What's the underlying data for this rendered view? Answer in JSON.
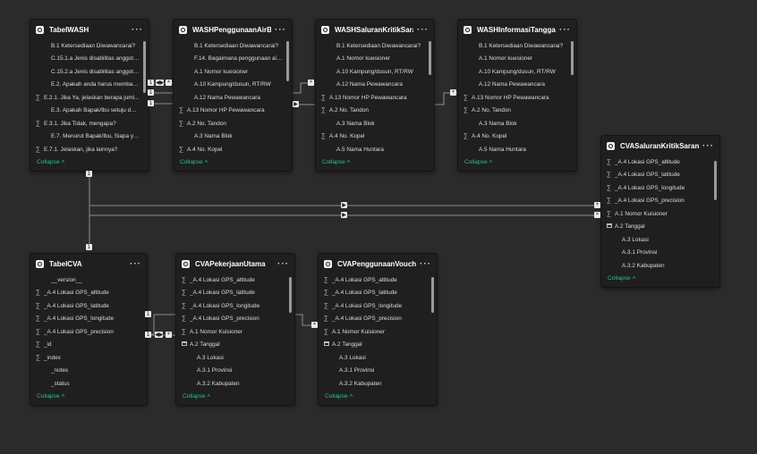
{
  "cards": [
    {
      "id": "tabel-wash",
      "title": "TabelWASH",
      "rows": [
        {
          "icon": "",
          "text": "B.1 Ketersediaan Diwawancarai?"
        },
        {
          "icon": "",
          "text": "C.15.1.a Jenis disabilitas anggota ..."
        },
        {
          "icon": "",
          "text": "C.15.2.a Jenis disabilitas anggota ..."
        },
        {
          "icon": "",
          "text": "E.2. Apakah anda harus membaya..."
        },
        {
          "icon": "sigma",
          "text": "E.2.1. Jika Ya, jelaskan berapa juml..."
        },
        {
          "icon": "",
          "text": "E.3. Apakah Bapak/Ibu setuju den..."
        },
        {
          "icon": "sigma",
          "text": "E.3.1. Jika Tidak, mengapa?"
        },
        {
          "icon": "",
          "text": "E.7. Menurut Bapak/Ibu, Siapa ya..."
        },
        {
          "icon": "sigma",
          "text": "E.7.1. Jelaskan, jika lainnya?"
        }
      ]
    },
    {
      "id": "wash-penggunaan",
      "title": "WASHPenggunaanAirB...",
      "rows": [
        {
          "icon": "",
          "text": "B.1 Ketersediaan Diwawancarai?"
        },
        {
          "icon": "",
          "text": "F.14. Bagaimana penggunaan air ..."
        },
        {
          "icon": "",
          "text": "A.1 Nomor kuesioner"
        },
        {
          "icon": "",
          "text": "A.10 Kampung/dusun, RT/RW"
        },
        {
          "icon": "",
          "text": "A.12 Nama Pewawancara"
        },
        {
          "icon": "sigma",
          "text": "A.13 Nomor HP Pewawancara"
        },
        {
          "icon": "sigma",
          "text": "A.2 No. Tandon"
        },
        {
          "icon": "",
          "text": "A.3 Nama Blok"
        },
        {
          "icon": "sigma",
          "text": "A.4 No. Kopel"
        }
      ]
    },
    {
      "id": "wash-saluran",
      "title": "WASHSaluranKritikSaran",
      "rows": [
        {
          "icon": "",
          "text": "B.1 Ketersediaan Diwawancarai?"
        },
        {
          "icon": "",
          "text": "A.1 Nomor kuesioner"
        },
        {
          "icon": "",
          "text": "A.10 Kampung/dusun, RT/RW"
        },
        {
          "icon": "",
          "text": "A.12 Nama Pewawancara"
        },
        {
          "icon": "sigma",
          "text": "A.13 Nomor HP Pewawancara"
        },
        {
          "icon": "sigma",
          "text": "A.2 No. Tandon"
        },
        {
          "icon": "",
          "text": "A.3 Nama Blok"
        },
        {
          "icon": "sigma",
          "text": "A.4 No. Kopel"
        },
        {
          "icon": "",
          "text": "A.5 Nama Huntara"
        }
      ]
    },
    {
      "id": "wash-informasi",
      "title": "WASHInformasiTangga...",
      "rows": [
        {
          "icon": "",
          "text": "B.1 Ketersediaan Diwawancarai?"
        },
        {
          "icon": "",
          "text": "A.1 Nomor kuesioner"
        },
        {
          "icon": "",
          "text": "A.10 Kampung/dusun, RT/RW"
        },
        {
          "icon": "",
          "text": "A.12 Nama Pewawancara"
        },
        {
          "icon": "sigma",
          "text": "A.13 Nomor HP Pewawancara"
        },
        {
          "icon": "sigma",
          "text": "A.2 No. Tandon"
        },
        {
          "icon": "",
          "text": "A.3 Nama Blok"
        },
        {
          "icon": "sigma",
          "text": "A.4 No. Kopel"
        },
        {
          "icon": "",
          "text": "A.5 Nama Huntara"
        }
      ]
    },
    {
      "id": "cva-saluran",
      "title": "CVASaluranKritikSaranFav",
      "rows": [
        {
          "icon": "sigma",
          "text": "_A.4 Lokasi GPS_altitude"
        },
        {
          "icon": "sigma",
          "text": "_A.4 Lokasi GPS_latitude"
        },
        {
          "icon": "sigma",
          "text": "_A.4 Lokasi GPS_longitude"
        },
        {
          "icon": "sigma",
          "text": "_A.4 Lokasi GPS_precision"
        },
        {
          "icon": "sigma",
          "text": "A.1 Nomor Kuisioner"
        },
        {
          "icon": "calendar",
          "text": "A.2 Tanggal"
        },
        {
          "icon": "indent",
          "text": "A.3 Lokasi"
        },
        {
          "icon": "indent",
          "text": "A.3.1 Provinsi"
        },
        {
          "icon": "indent",
          "text": "A.3.2 Kabupaten"
        }
      ]
    },
    {
      "id": "tabel-cva",
      "title": "TabelCVA",
      "rows": [
        {
          "icon": "indent",
          "text": "__version__"
        },
        {
          "icon": "sigma",
          "text": "_A.4 Lokasi GPS_altitude"
        },
        {
          "icon": "sigma",
          "text": "_A.4 Lokasi GPS_latitude"
        },
        {
          "icon": "sigma",
          "text": "_A.4 Lokasi GPS_longitude"
        },
        {
          "icon": "sigma",
          "text": "_A.4 Lokasi GPS_precision"
        },
        {
          "icon": "sigma",
          "text": "_id"
        },
        {
          "icon": "sigma",
          "text": "_index"
        },
        {
          "icon": "indent",
          "text": "_notes"
        },
        {
          "icon": "indent",
          "text": "_status"
        }
      ]
    },
    {
      "id": "cva-pekerjaan",
      "title": "CVAPekerjaanUtama",
      "rows": [
        {
          "icon": "sigma",
          "text": "_A.4 Lokasi GPS_altitude"
        },
        {
          "icon": "sigma",
          "text": "_A.4 Lokasi GPS_latitude"
        },
        {
          "icon": "sigma",
          "text": "_A.4 Lokasi GPS_longitude"
        },
        {
          "icon": "sigma",
          "text": "_A.4 Lokasi GPS_precision"
        },
        {
          "icon": "sigma",
          "text": "A.1 Nomor Kuisioner"
        },
        {
          "icon": "calendar",
          "text": "A.2 Tanggal"
        },
        {
          "icon": "indent",
          "text": "A.3 Lokasi"
        },
        {
          "icon": "indent",
          "text": "A.3.1 Provinsi"
        },
        {
          "icon": "indent",
          "text": "A.3.2 Kabupaten"
        }
      ]
    },
    {
      "id": "cva-penggunaan",
      "title": "CVAPenggunaanVoucher",
      "rows": [
        {
          "icon": "sigma",
          "text": "_A.4 Lokasi GPS_altitude"
        },
        {
          "icon": "sigma",
          "text": "_A.4 Lokasi GPS_latitude"
        },
        {
          "icon": "sigma",
          "text": "_A.4 Lokasi GPS_longitude"
        },
        {
          "icon": "sigma",
          "text": "_A.4 Lokasi GPS_precision"
        },
        {
          "icon": "sigma",
          "text": "A.1 Nomor Kuisioner"
        },
        {
          "icon": "calendar",
          "text": "A.2 Tanggal"
        },
        {
          "icon": "indent",
          "text": "A.3 Lokasi"
        },
        {
          "icon": "indent",
          "text": "A.3.1 Provinsi"
        },
        {
          "icon": "indent",
          "text": "A.3.2 Kabupaten"
        }
      ]
    }
  ],
  "ui": {
    "collapse_label": "Collapse",
    "more_label": "···",
    "sigma_glyph": "∑",
    "cardinality_one": "1",
    "cardinality_many": "*",
    "filter_arrow": "▶",
    "filter_both": "◀▶"
  },
  "colors": {
    "canvas": "#2b2b2b",
    "card": "#1f1f1f",
    "accent": "#2fbf8f",
    "line": "#8c8c8c"
  }
}
